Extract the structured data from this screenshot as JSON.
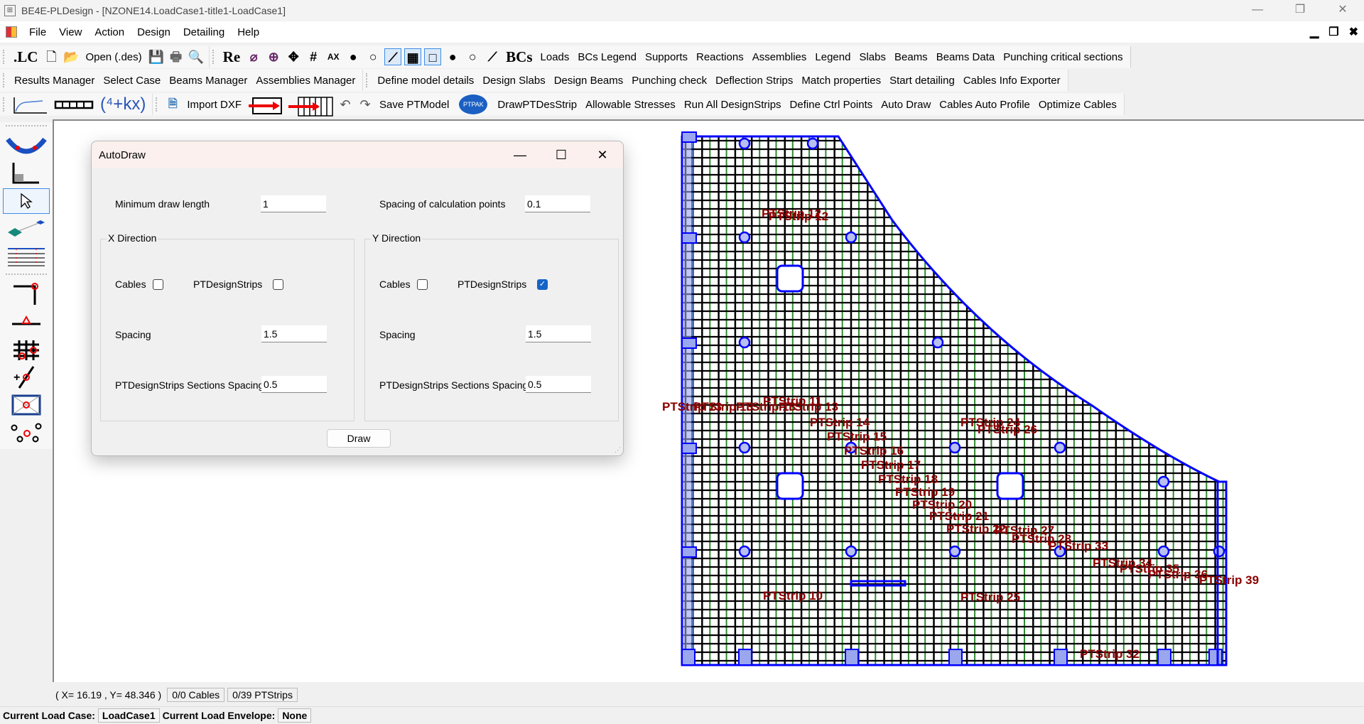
{
  "window": {
    "title": "BE4E-PLDesign - [NZONE14.LoadCase1-title1-LoadCase1]",
    "controls": [
      "minimize",
      "restore",
      "close"
    ]
  },
  "menubar": {
    "items": [
      "File",
      "View",
      "Action",
      "Design",
      "Detailing",
      "Help"
    ],
    "mdi_controls": [
      "minimize",
      "restore",
      "close"
    ]
  },
  "toolbar1": {
    "lc_label": ".LC",
    "open_label": "Open (.des)",
    "re_label": "Re",
    "bcs_label": "BCs",
    "buttons": [
      "Loads",
      "BCs Legend",
      "Supports",
      "Reactions",
      "Assemblies",
      "Legend",
      "Slabs",
      "Beams",
      "Beams Data",
      "Punching critical sections"
    ]
  },
  "toolbar2": {
    "group1": [
      "Results Manager",
      "Select Case",
      "Beams Manager",
      "Assemblies Manager"
    ],
    "group2": [
      "Define model details",
      "Design Slabs",
      "Design Beams",
      "Punching check",
      "Deflection Strips",
      "Match properties",
      "Start detailing",
      "Cables Info Exporter"
    ]
  },
  "toolbar3": {
    "formula_label": "(⁴+kx)",
    "import_dxf": "Import DXF",
    "save_model": "Save PTModel",
    "ptpak": "PTPAK",
    "buttons": [
      "DrawPTDesStrip",
      "Allowable Stresses",
      "Run All DesignStrips",
      "Define Ctrl Points",
      "Auto Draw",
      "Cables Auto Profile",
      "Optimize Cables"
    ]
  },
  "left_tools": [
    "cable-tool",
    "section-tool",
    "select-tool",
    "link-tool",
    "strips-tool",
    "column-corner-tool",
    "support-tool",
    "grid-column-tool",
    "add-point-tool",
    "slab-region-tool",
    "points-tool"
  ],
  "dialog": {
    "title": "AutoDraw",
    "min_draw_length_label": "Minimum draw length",
    "min_draw_length": "1",
    "calc_spacing_label": "Spacing of calculation points",
    "calc_spacing": "0.1",
    "x_direction": {
      "title": "X Direction",
      "cables_label": "Cables",
      "cables_checked": false,
      "strips_label": "PTDesignStrips",
      "strips_checked": false,
      "spacing_label": "Spacing",
      "spacing": "1.5",
      "sections_label": "PTDesignStrips Sections Spacing",
      "sections_spacing": "0.5"
    },
    "y_direction": {
      "title": "Y Direction",
      "cables_label": "Cables",
      "cables_checked": false,
      "strips_label": "PTDesignStrips",
      "strips_checked": true,
      "spacing_label": "Spacing",
      "spacing": "1.5",
      "sections_label": "PTDesignStrips Sections Spacing",
      "sections_spacing": "0.5"
    },
    "draw_button": "Draw"
  },
  "canvas": {
    "strip_labels": [
      "PTStrip 12",
      "PTStrip 11",
      "PTStrip 13",
      "PTStrip 14",
      "PTStrip 15",
      "PTStrip 16",
      "PTStrip 17",
      "PTStrip 18",
      "PTStrip 19",
      "PTStrip 20",
      "PTStrip 21",
      "PTStrip 22",
      "PTStrip 24",
      "PTStrip 26",
      "PTStrip 27",
      "PTStrip 28",
      "PTStrip 33",
      "PTStrip 34",
      "PTStrip 35",
      "PTStrip 36",
      "PTStrip 39",
      "PTStrip 10",
      "PTStrip 25",
      "PTStrip 32"
    ],
    "colors": {
      "slab_outline": "#0000ff",
      "mesh": "#000000",
      "mesh_minor": "#2e8b2e",
      "labels": "#8b0000"
    }
  },
  "status": {
    "coords": "( X= 16.19 , Y= 48.346 )",
    "cables": "0/0 Cables",
    "strips": "0/39 PTStrips",
    "load_case_label": "Current Load Case:",
    "load_case": "LoadCase1",
    "load_envelope_label": "Current Load Envelope:",
    "load_envelope": "None"
  }
}
